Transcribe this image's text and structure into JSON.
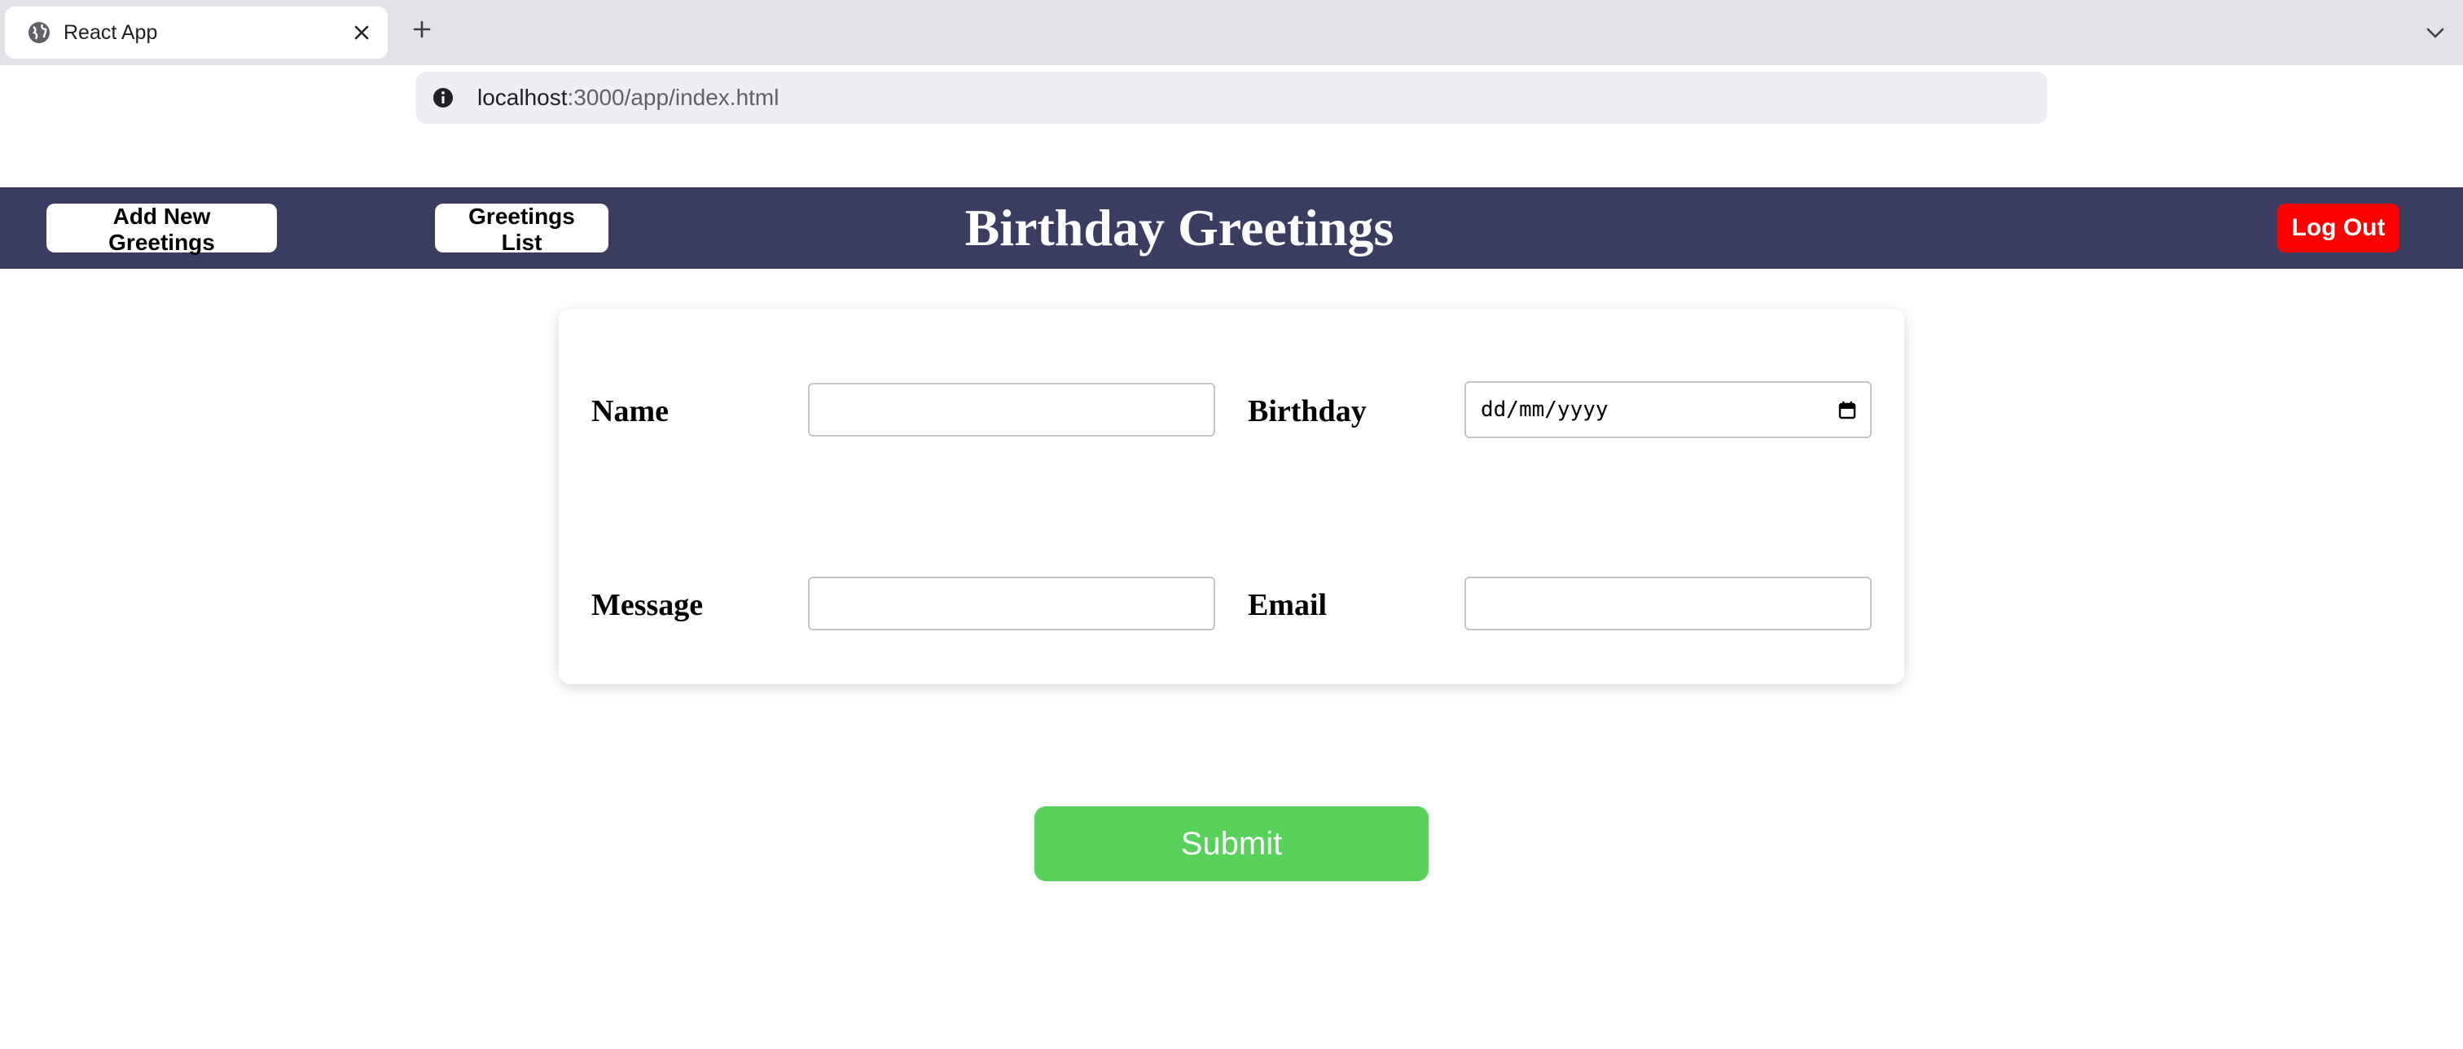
{
  "browser": {
    "tab_title": "React App",
    "url_host": "localhost",
    "url_path": ":3000/app/index.html"
  },
  "header": {
    "add_button": "Add New Greetings",
    "list_button": "Greetings List",
    "title": "Birthday Greetings",
    "logout_button": "Log Out"
  },
  "form": {
    "name_label": "Name",
    "birthday_label": "Birthday",
    "birthday_placeholder": "dd/mm/yyyy",
    "message_label": "Message",
    "email_label": "Email",
    "name_value": "",
    "message_value": "",
    "email_value": ""
  },
  "submit_label": "Submit",
  "colors": {
    "header_bg": "#3a3c62",
    "logout_bg": "#ff0000",
    "submit_bg": "#58d15a"
  },
  "icons": {
    "tab_favicon": "globe-icon",
    "tab_close": "close-icon",
    "new_tab": "plus-icon",
    "tab_menu": "chevron-down-icon",
    "site_info": "info-icon",
    "date_picker": "calendar-icon"
  }
}
